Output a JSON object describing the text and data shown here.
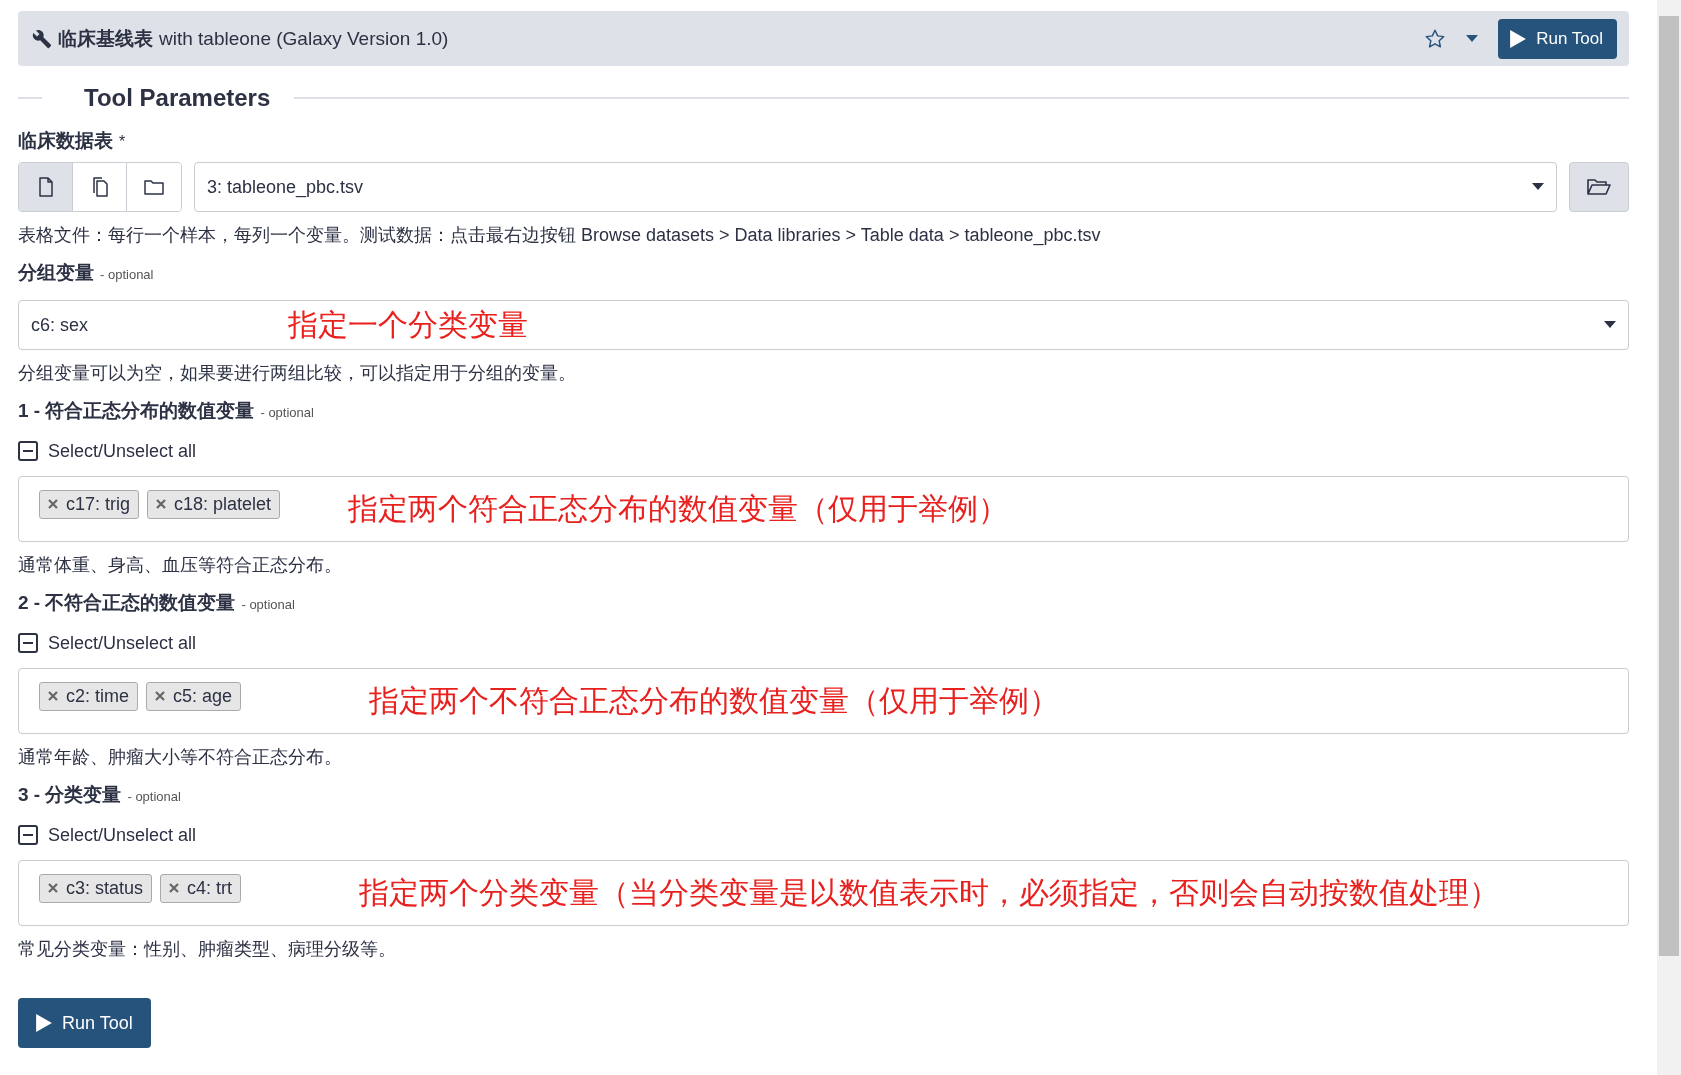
{
  "header": {
    "title_bold": "临床基线表",
    "title_rest": "with tableone (Galaxy Version 1.0)",
    "favorite": false,
    "run_button": "Run Tool"
  },
  "section_title": "Tool Parameters",
  "dataset": {
    "label": "临床数据表",
    "required_mark": "*",
    "sources": [
      {
        "kind": "single",
        "selected": true
      },
      {
        "kind": "multiple",
        "selected": false
      },
      {
        "kind": "collection",
        "selected": false
      }
    ],
    "value": "3: tableone_pbc.tsv",
    "help": "表格文件：每行一个样本，每列一个变量。测试数据：点击最右边按钮 Browse datasets > Data libraries > Table data > tableone_pbc.tsv"
  },
  "group": {
    "label": "分组变量",
    "optional": "- optional",
    "value": "c6: sex",
    "annotation": "指定一个分类变量",
    "help": "分组变量可以为空，如果要进行两组比较，可以指定用于分组的变量。"
  },
  "params": [
    {
      "label": "1 - 符合正态分布的数值变量",
      "optional": "- optional",
      "select_all": "Select/Unselect all",
      "indeterminate": true,
      "chips": [
        "c17: trig",
        "c18: platelet"
      ],
      "annotation": "指定两个符合正态分布的数值变量（仅用于举例）",
      "help": "通常体重、身高、血压等符合正态分布。"
    },
    {
      "label": "2 - 不符合正态的数值变量",
      "optional": "- optional",
      "select_all": "Select/Unselect all",
      "indeterminate": true,
      "chips": [
        "c2: time",
        "c5: age"
      ],
      "annotation": "指定两个不符合正态分布的数值变量（仅用于举例）",
      "help": "通常年龄、肿瘤大小等不符合正态分布。"
    },
    {
      "label": "3 - 分类变量",
      "optional": "- optional",
      "select_all": "Select/Unselect all",
      "indeterminate": true,
      "chips": [
        "c3: status",
        "c4: trt"
      ],
      "annotation": "指定两个分类变量（当分类变量是以数值表示时，必须指定，否则会自动按数值处理）",
      "help": "常见分类变量：性别、肿瘤类型、病理分级等。"
    }
  ],
  "run_button": "Run Tool"
}
